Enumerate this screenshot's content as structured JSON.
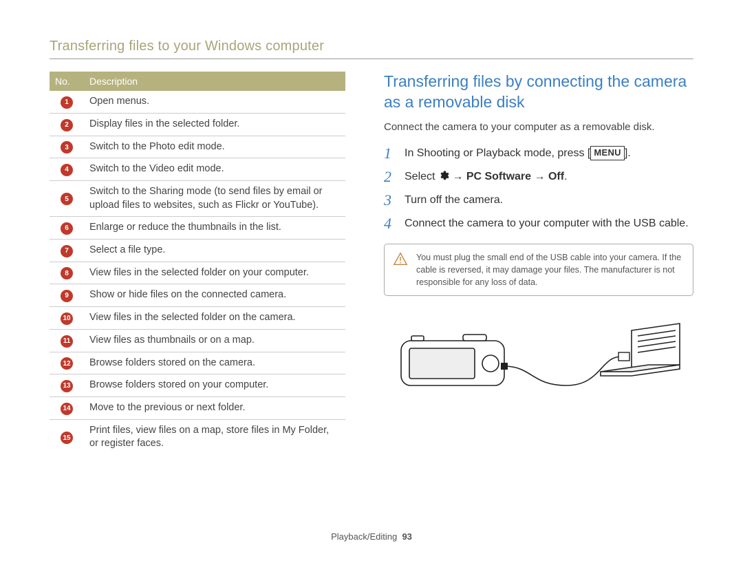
{
  "header": {
    "title": "Transferring files to your Windows computer"
  },
  "table": {
    "header_no": "No.",
    "header_desc": "Description",
    "rows": [
      {
        "n": "1",
        "desc": "Open menus."
      },
      {
        "n": "2",
        "desc": "Display files in the selected folder."
      },
      {
        "n": "3",
        "desc": "Switch to the Photo edit mode."
      },
      {
        "n": "4",
        "desc": "Switch to the Video edit mode."
      },
      {
        "n": "5",
        "desc": "Switch to the Sharing mode (to send files by email or upload files to websites, such as Flickr or YouTube)."
      },
      {
        "n": "6",
        "desc": "Enlarge or reduce the thumbnails in the list."
      },
      {
        "n": "7",
        "desc": "Select a file type."
      },
      {
        "n": "8",
        "desc": "View files in the selected folder on your computer."
      },
      {
        "n": "9",
        "desc": "Show or hide files on the connected camera."
      },
      {
        "n": "10",
        "desc": "View files in the selected folder on the camera."
      },
      {
        "n": "11",
        "desc": "View files as thumbnails or on a map."
      },
      {
        "n": "12",
        "desc": "Browse folders stored on the camera."
      },
      {
        "n": "13",
        "desc": "Browse folders stored on your computer."
      },
      {
        "n": "14",
        "desc": "Move to the previous or next folder."
      },
      {
        "n": "15",
        "desc": "Print files, view files on a map, store files in My Folder, or register faces."
      }
    ]
  },
  "section": {
    "heading": "Transferring files by connecting the camera as a removable disk",
    "sub": "Connect the camera to your computer as a removable disk.",
    "steps": {
      "s1_a": "In Shooting or Playback mode, press [",
      "s1_menu": "MENU",
      "s1_b": "].",
      "s2_a": "Select ",
      "s2_arrow1": " → ",
      "s2_bold1": "PC Software",
      "s2_arrow2": " → ",
      "s2_bold2": "Off",
      "s2_period": ".",
      "s3": "Turn off the camera.",
      "s4": "Connect the camera to your computer with the USB cable."
    },
    "warning": "You must plug the small end of the USB cable into your camera. If the cable is reversed, it may damage your files. The manufacturer is not responsible for any loss of data."
  },
  "footer": {
    "section": "Playback/Editing",
    "page": "93"
  }
}
